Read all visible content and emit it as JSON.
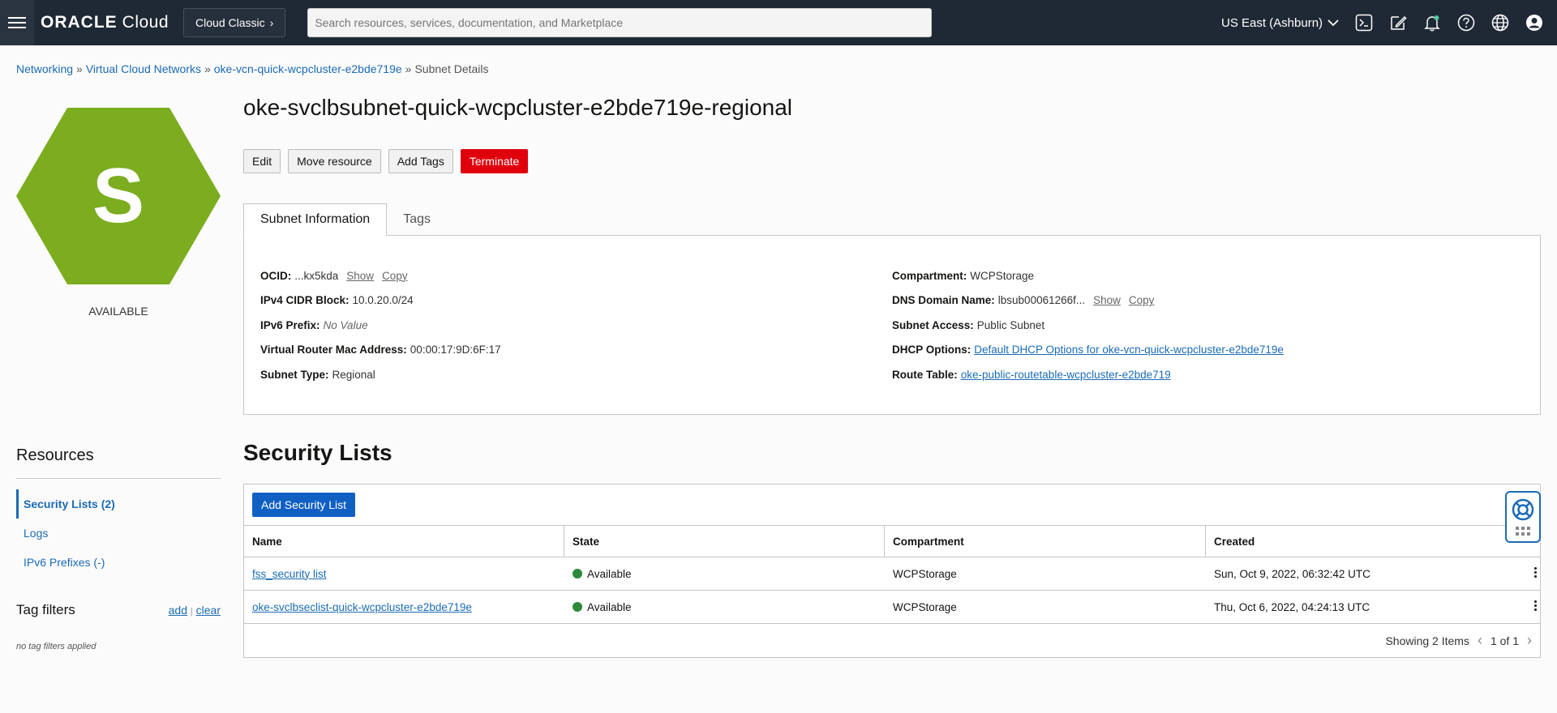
{
  "topbar": {
    "logo_brand": "ORACLE",
    "logo_product": "Cloud",
    "classic_label": "Cloud Classic",
    "search_placeholder": "Search resources, services, documentation, and Marketplace",
    "region": "US East (Ashburn)",
    "icons": [
      "cloud-shell-icon",
      "edit-icon",
      "bell-icon",
      "help-icon",
      "globe-icon",
      "user-icon"
    ]
  },
  "breadcrumb": {
    "items": [
      "Networking",
      "Virtual Cloud Networks",
      "oke-vcn-quick-wcpcluster-e2bde719e"
    ],
    "current": "Subnet Details",
    "separator": "»"
  },
  "resource_badge": {
    "letter": "S",
    "status": "AVAILABLE",
    "color": "#7bad1f"
  },
  "title": "oke-svclbsubnet-quick-wcpcluster-e2bde719e-regional",
  "actions": {
    "edit": "Edit",
    "move": "Move resource",
    "tags": "Add Tags",
    "terminate": "Terminate"
  },
  "tabs": {
    "info": "Subnet Information",
    "tags": "Tags"
  },
  "info_left": [
    {
      "label": "OCID:",
      "value": "...kx5kda",
      "show": "Show",
      "copy": "Copy"
    },
    {
      "label": "IPv4 CIDR Block:",
      "value": "10.0.20.0/24"
    },
    {
      "label": "IPv6 Prefix:",
      "value": "No Value"
    },
    {
      "label": "Virtual Router Mac Address:",
      "value": "00:00:17:9D:6F:17"
    },
    {
      "label": "Subnet Type:",
      "value": "Regional"
    }
  ],
  "info_right": [
    {
      "label": "Compartment:",
      "value": "WCPStorage"
    },
    {
      "label": "DNS Domain Name:",
      "value": "lbsub00061266f...",
      "show": "Show",
      "copy": "Copy"
    },
    {
      "label": "Subnet Access:",
      "value": "Public Subnet"
    },
    {
      "label": "DHCP Options:",
      "value": "Default DHCP Options for oke-vcn-quick-wcpcluster-e2bde719e"
    },
    {
      "label": "Route Table:",
      "value": "oke-public-routetable-wcpcluster-e2bde719"
    }
  ],
  "resources": {
    "title": "Resources",
    "items": [
      "Security Lists (2)",
      "Logs",
      "IPv6 Prefixes (-)"
    ],
    "tag_filters": "Tag filters",
    "add": "add",
    "clear": "clear",
    "divider": "|",
    "empty": "no tag filters applied"
  },
  "security_lists": {
    "title": "Security Lists",
    "add_button": "Add Security List",
    "columns": [
      "Name",
      "State",
      "Compartment",
      "Created"
    ],
    "rows": [
      {
        "name": "fss_security list",
        "state": "Available",
        "compartment": "WCPStorage",
        "created": "Sun, Oct 9, 2022, 06:32:42 UTC"
      },
      {
        "name": "oke-svclbseclist-quick-wcpcluster-e2bde719e",
        "state": "Available",
        "compartment": "WCPStorage",
        "created": "Thu, Oct 6, 2022, 04:24:13 UTC"
      }
    ],
    "showing": "Showing 2 Items",
    "page": "1 of 1"
  }
}
